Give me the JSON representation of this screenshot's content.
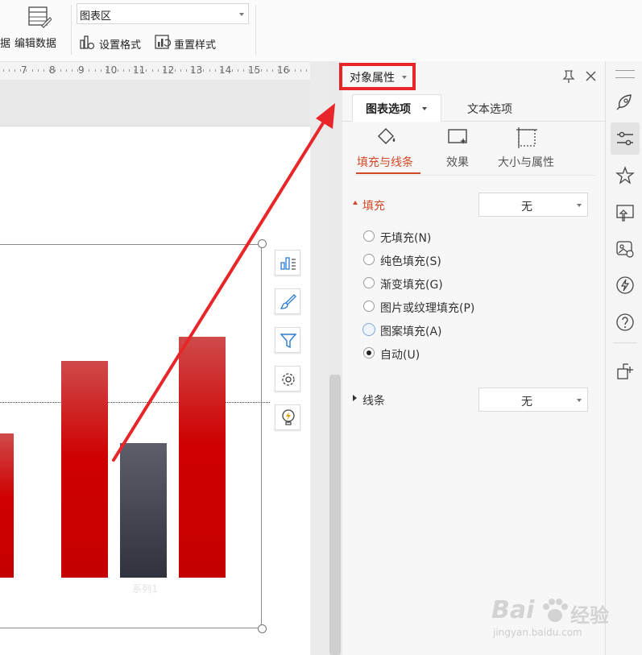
{
  "toolbar": {
    "left_partial_label": "据",
    "edit_data_label": "编辑数据",
    "chart_area_select_value": "图表区",
    "format_selection_label": "设置格式",
    "reset_style_label": "重置样式"
  },
  "ruler": {
    "numbers": [
      "7",
      "8",
      "9",
      "10",
      "11",
      "12",
      "13",
      "14",
      "15",
      "16"
    ]
  },
  "chart": {
    "x_category_label": "系列1",
    "colors": {
      "red": "#cc0000",
      "dark": "#3a3d48",
      "red_top": "#cf4a4a"
    }
  },
  "chart_side_tools": [
    "chart-elements-icon",
    "chart-style-brush-icon",
    "chart-filter-icon",
    "chart-settings-gear-icon",
    "smart-suggest-bulb-icon"
  ],
  "panel": {
    "title": "对象属性",
    "tabs": {
      "chart_options": "图表选项",
      "text_options": "文本选项"
    },
    "subtabs": {
      "fill_line": "填充与线条",
      "effects": "效果",
      "size_props": "大小与属性"
    },
    "fill": {
      "heading": "填充",
      "dropdown_value": "无",
      "options": [
        "无填充(N)",
        "纯色填充(S)",
        "渐变填充(G)",
        "图片或纹理填充(P)",
        "图案填充(A)",
        "自动(U)"
      ],
      "selected": "自动(U)"
    },
    "line": {
      "heading": "线条",
      "dropdown_value": "无"
    }
  },
  "right_rail_icons": [
    "rocket-icon",
    "adjust-sliders-icon",
    "star-pen-icon",
    "screen-share-icon",
    "image-tool-icon",
    "lightning-icon",
    "help-icon",
    "shape-add-icon"
  ],
  "watermark": {
    "brand": "Bai",
    "brand2": "经验",
    "url": "jingyan.baidu.com"
  },
  "accent_color": "#d24726",
  "annotation_color": "#e8262a"
}
